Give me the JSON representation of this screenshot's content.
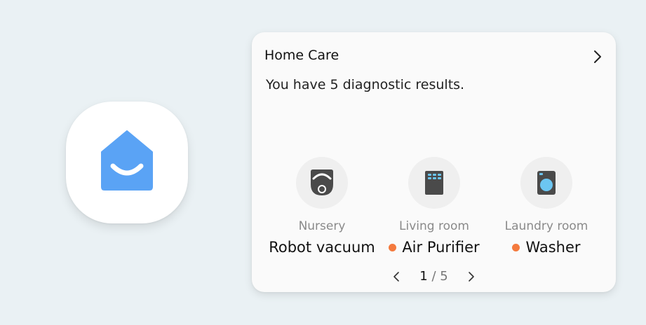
{
  "app": {
    "icon_name": "home-care-icon",
    "accent_color": "#5aa3f5"
  },
  "card": {
    "title": "Home Care",
    "subtitle": "You have 5 diagnostic results.",
    "devices": [
      {
        "room": "Nursery",
        "name": "Robot vacuum",
        "has_status": false,
        "icon": "robot-vacuum-icon"
      },
      {
        "room": "Living room",
        "name": "Air Purifier",
        "has_status": true,
        "icon": "air-purifier-icon"
      },
      {
        "room": "Laundry room",
        "name": "Washer",
        "has_status": true,
        "icon": "washer-icon"
      }
    ],
    "status_color": "#f47a3e",
    "pager": {
      "current": "1",
      "separator": "/",
      "total": "5"
    }
  }
}
